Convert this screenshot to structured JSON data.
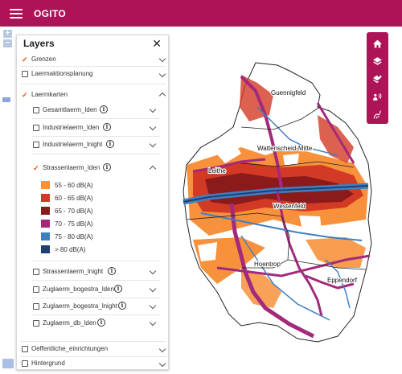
{
  "app": {
    "title": "OGITO"
  },
  "zoom": {
    "in": "+",
    "out": "−"
  },
  "panel": {
    "title": "Layers",
    "close": "✕",
    "items": {
      "grenzen": {
        "label": "Grenzen",
        "checked": true
      },
      "laermaktionsplanung": {
        "label": "Laermaktionsplanung",
        "checked": false
      },
      "laermkarten": {
        "label": "Laermkarten",
        "checked": true
      },
      "gesamtlaerm_lden": {
        "label": "Gesamtlaerm_lden",
        "checked": false
      },
      "industrielaerm_lden": {
        "label": "Industrielaerm_lden",
        "checked": false
      },
      "industrielaerm_lnight": {
        "label": "Industrielaerm_lnight",
        "checked": false
      },
      "strassenlaerm_lden": {
        "label": "Strassenlaerm_lden",
        "checked": true
      },
      "strassenlaerm_lnight": {
        "label": "Strassenlaerm_lnight",
        "checked": false
      },
      "zuglaerm_bogestra_lden": {
        "label": "Zuglaerm_bogestra_lden",
        "checked": false
      },
      "zuglaerm_bogestra_lnight": {
        "label": "Zuglaerm_bogestra_lnight",
        "checked": false
      },
      "zuglaerm_db_lden": {
        "label": "Zuglaerm_db_lden",
        "checked": false
      },
      "oeffentliche_einrichtungen": {
        "label": "Oeffentliche_einrichtungen",
        "checked": false
      },
      "hintergrund": {
        "label": "Hintergrund",
        "checked": false
      }
    },
    "info_glyph": "i",
    "legend": [
      {
        "label": "55 - 60 dB(A)",
        "color": "#f7913c"
      },
      {
        "label": "60 - 65 dB(A)",
        "color": "#d33a26"
      },
      {
        "label": "65 - 70 dB(A)",
        "color": "#8b1a1a"
      },
      {
        "label": "70 - 75 dB(A)",
        "color": "#a32a7a"
      },
      {
        "label": "75 - 80 dB(A)",
        "color": "#3f7fc1"
      },
      {
        "label": "> 80 dB(A)",
        "color": "#1f3f73"
      }
    ]
  },
  "tools": [
    {
      "icon": "home-icon"
    },
    {
      "icon": "layers-icon"
    },
    {
      "icon": "layers-edit-icon"
    },
    {
      "icon": "hearing-icon"
    },
    {
      "icon": "route-icon"
    }
  ],
  "map": {
    "places": [
      "Guennigfeld",
      "Wattenscheid-Mitte",
      "Leithe",
      "Westenfeld",
      "Hoentrop",
      "Eppendorf"
    ]
  },
  "colors": {
    "brand": "#ad1457",
    "accent_check": "#e65100"
  }
}
